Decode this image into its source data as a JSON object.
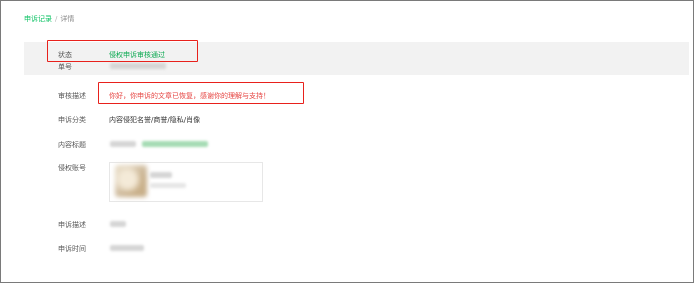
{
  "breadcrumb": {
    "parent": "申诉记录",
    "separator": "/",
    "current": "详情"
  },
  "fields": {
    "status_label": "状态",
    "status_value": "侵权申诉审核通过",
    "number_label": "单号",
    "review_label": "审核描述",
    "review_value": "你好，你申诉的文章已恢复，感谢你的理解与支持！",
    "category_label": "申诉分类",
    "category_value": "内容侵犯名誉/商誉/隐私/肖像",
    "title_label": "内容标题",
    "account_label": "侵权账号",
    "description_label": "申诉描述",
    "time_label": "申诉时间"
  },
  "colors": {
    "accent_green": "#07c160",
    "status_green": "#07a84e",
    "notice_red": "#e64340",
    "highlight_box": "#e8211c"
  }
}
